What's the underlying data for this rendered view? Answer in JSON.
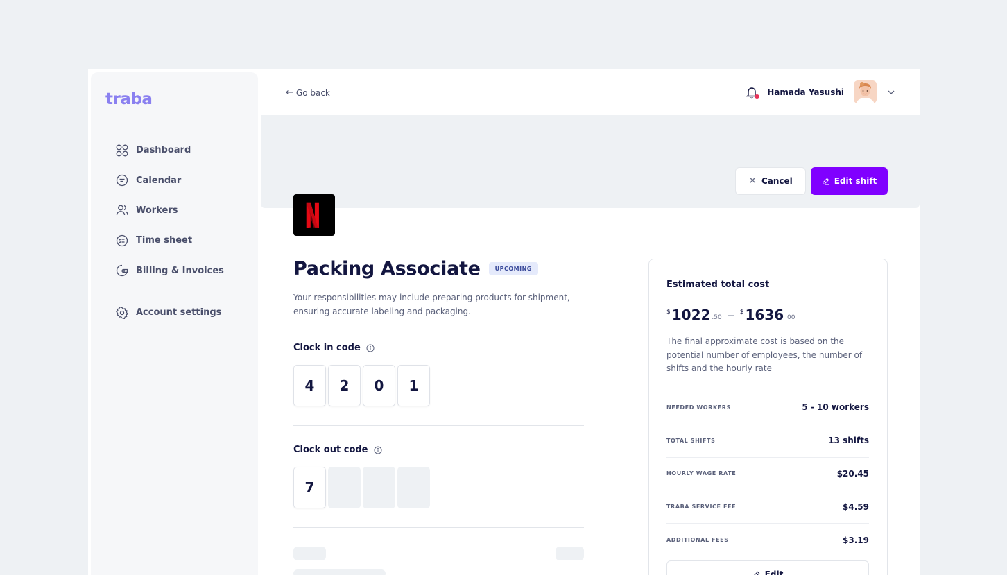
{
  "brand": {
    "logo_text": "traba",
    "accent": "#8000ff",
    "logo_color": "#8a80f0"
  },
  "sidebar": {
    "items": [
      {
        "label": "Dashboard",
        "icon": "grid-icon"
      },
      {
        "label": "Calendar",
        "icon": "calendar-icon"
      },
      {
        "label": "Workers",
        "icon": "users-icon"
      },
      {
        "label": "Time sheet",
        "icon": "timesheet-icon"
      },
      {
        "label": "Billing & Invoices",
        "icon": "wallet-icon"
      }
    ],
    "settings": {
      "label": "Account settings",
      "icon": "gear-icon"
    }
  },
  "topbar": {
    "go_back": "Go back",
    "user_name": "Hamada Yasushi",
    "has_notification": true
  },
  "actions": {
    "cancel": "Cancel",
    "edit_shift": "Edit shift"
  },
  "shift": {
    "title": "Packing Associate",
    "status": "UPCOMING",
    "description": "Your responsibilities may include preparing products for shipment, ensuring accurate labeling and packaging.",
    "clock_in": {
      "label": "Clock in code",
      "digits": [
        "4",
        "2",
        "0",
        "1"
      ]
    },
    "clock_out": {
      "label": "Clock out code",
      "digits": [
        "7",
        "",
        "",
        ""
      ]
    }
  },
  "cost": {
    "title": "Estimated total cost",
    "currency": "$",
    "low_whole": "1022",
    "low_cents": ".50",
    "high_whole": "1636",
    "high_cents": ".00",
    "description": "The final approximate cost is based on the potential number of employees, the number of shifts and the hourly rate",
    "rows": [
      {
        "label": "NEEDED WORKERS",
        "value": "5 - 10 workers"
      },
      {
        "label": "TOTAL SHIFTS",
        "value": "13 shifts"
      },
      {
        "label": "HOURLY WAGE RATE",
        "value": "$20.45"
      },
      {
        "label": "TRABA SERVICE FEE",
        "value": "$4.59"
      },
      {
        "label": "ADDITIONAL FEES",
        "value": "$3.19"
      }
    ],
    "edit_label": "Edit"
  }
}
